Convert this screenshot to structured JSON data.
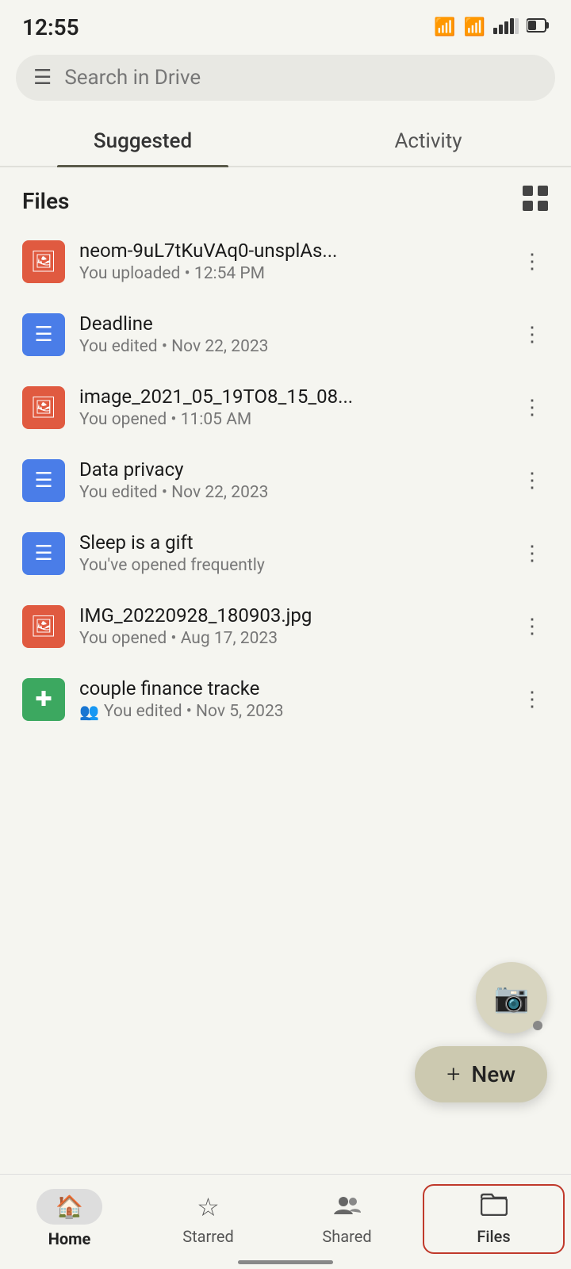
{
  "statusBar": {
    "time": "12:55"
  },
  "searchBar": {
    "placeholder": "Search in Drive",
    "icon": "☰"
  },
  "tabs": [
    {
      "id": "suggested",
      "label": "Suggested",
      "active": true
    },
    {
      "id": "activity",
      "label": "Activity",
      "active": false
    }
  ],
  "filesSection": {
    "title": "Files",
    "gridIcon": "⊞"
  },
  "files": [
    {
      "id": "file1",
      "name": "neom-9uL7tKuVAq0-unsplAs...",
      "meta": "You uploaded • 12:54 PM",
      "type": "image",
      "thumbColor": "red",
      "shared": false
    },
    {
      "id": "file2",
      "name": "Deadline",
      "meta": "You edited • Nov 22, 2023",
      "type": "doc",
      "thumbColor": "blue",
      "shared": false
    },
    {
      "id": "file3",
      "name": "image_2021_05_19TO8_15_08...",
      "meta": "You opened • 11:05 AM",
      "type": "image",
      "thumbColor": "red",
      "shared": false
    },
    {
      "id": "file4",
      "name": "Data privacy",
      "meta": "You edited • Nov 22, 2023",
      "type": "doc",
      "thumbColor": "blue",
      "shared": false
    },
    {
      "id": "file5",
      "name": "Sleep is a gift",
      "meta": "You've opened frequently",
      "type": "doc",
      "thumbColor": "blue",
      "shared": false
    },
    {
      "id": "file6",
      "name": "IMG_20220928_180903.jpg",
      "meta": "You opened • Aug 17, 2023",
      "type": "image",
      "thumbColor": "red",
      "shared": false
    },
    {
      "id": "file7",
      "name": "couple finance tracke",
      "meta": "You edited • Nov 5, 2023",
      "type": "sheets",
      "thumbColor": "green",
      "shared": true
    }
  ],
  "fab": {
    "newLabel": "New"
  },
  "bottomNav": [
    {
      "id": "home",
      "label": "Home",
      "icon": "🏠",
      "active": true
    },
    {
      "id": "starred",
      "label": "Starred",
      "icon": "☆",
      "active": false
    },
    {
      "id": "shared",
      "label": "Shared",
      "icon": "👥",
      "active": false
    },
    {
      "id": "files",
      "label": "Files",
      "icon": "📁",
      "active": false,
      "highlighted": true
    }
  ]
}
